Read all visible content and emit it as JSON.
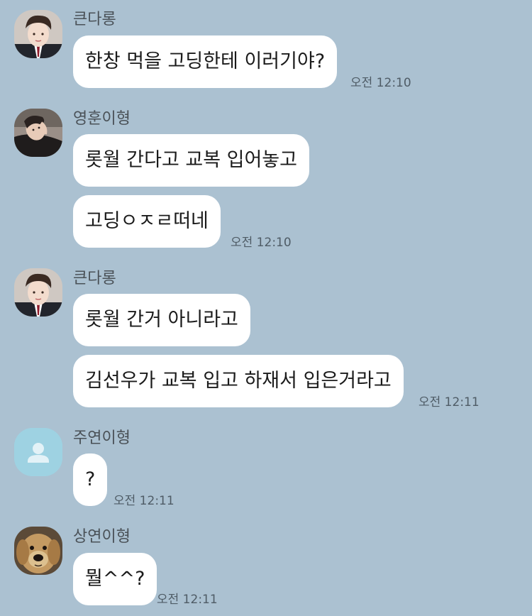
{
  "chat": {
    "messages": [
      {
        "sender": "큰다롱",
        "avatar_icon": "profile-photo-student-icon",
        "bubbles": [
          "한창 먹을 고딩한테 이러기야?"
        ],
        "time": "오전 12:10"
      },
      {
        "sender": "영훈이형",
        "avatar_icon": "profile-photo-lying-icon",
        "bubbles": [
          "롯월 간다고 교복 입어놓고",
          "고딩ㅇㅈㄹ떠네"
        ],
        "time": "오전 12:10"
      },
      {
        "sender": "큰다롱",
        "avatar_icon": "profile-photo-student-icon",
        "bubbles": [
          "롯월 간거 아니라고",
          "김선우가 교복 입고 하재서 입은거라고"
        ],
        "time": "오전 12:11"
      },
      {
        "sender": "주연이형",
        "avatar_icon": "default-profile-icon",
        "bubbles": [
          "?"
        ],
        "time": "오전 12:11"
      },
      {
        "sender": "상연이형",
        "avatar_icon": "profile-photo-dog-icon",
        "bubbles": [
          "뭘^^?"
        ],
        "time": "오전 12:11"
      }
    ]
  },
  "colors": {
    "background": "#abc1d1",
    "bubble": "#ffffff",
    "default_avatar": "#9ed2e2"
  }
}
